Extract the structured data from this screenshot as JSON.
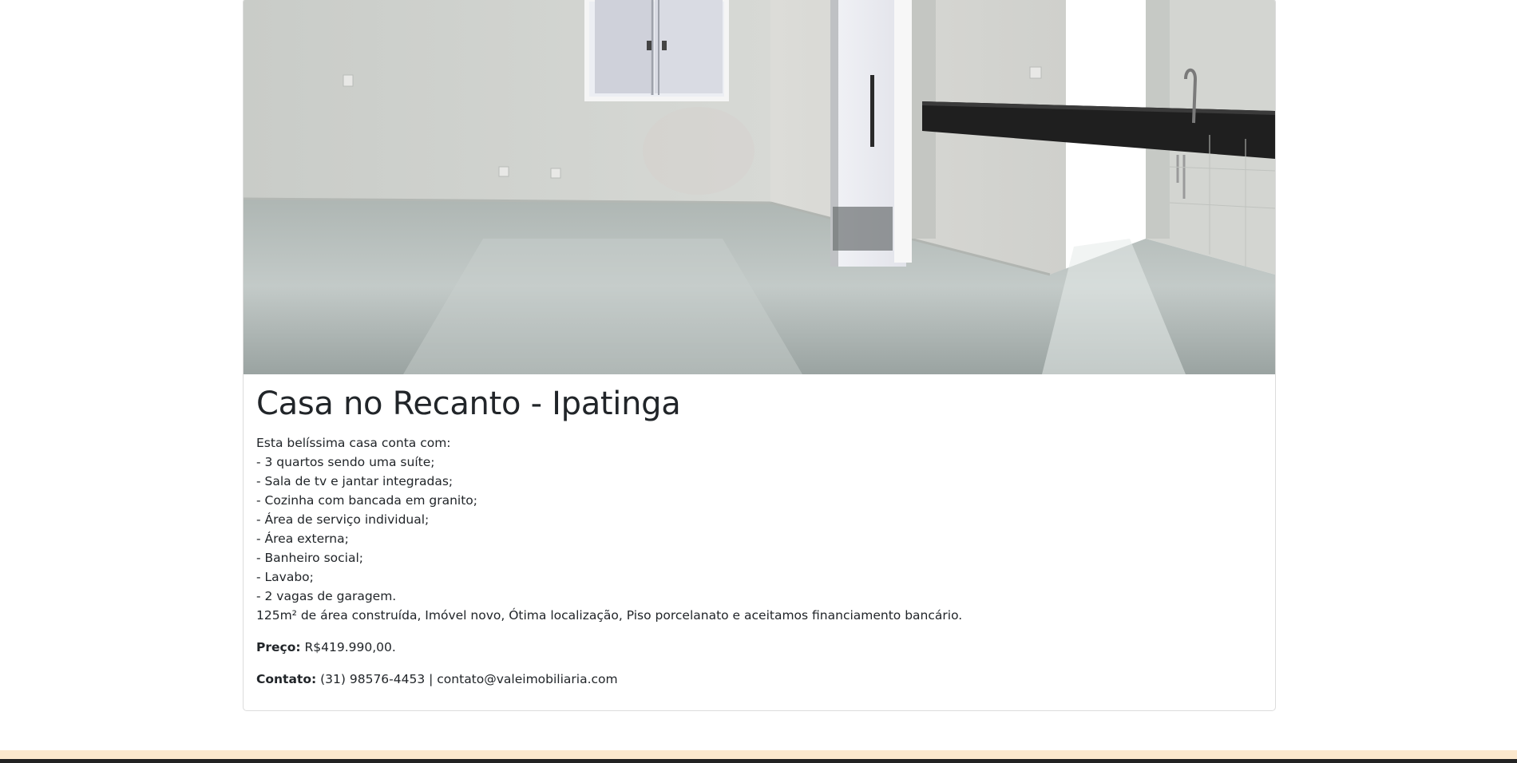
{
  "listing": {
    "title": "Casa no Recanto - Ipatinga",
    "photo_icon": "property-photo-empty-room",
    "description": [
      "Esta belíssima casa conta com:",
      "- 3 quartos sendo uma suíte;",
      "- Sala de tv e jantar integradas;",
      "- Cozinha com bancada em granito;",
      "- Área de serviço individual;",
      "- Área externa;",
      "- Banheiro social;",
      "- Lavabo;",
      "- 2 vagas de garagem.",
      "125m² de área construída, Imóvel novo, Ótima localização, Piso porcelanato e aceitamos financiamento bancário."
    ],
    "price_label": "Preço:",
    "price_value": " R$419.990,00.",
    "contact_label": "Contato:",
    "contact_value": " (31) 98576-4453 | contato@valeimobiliaria.com"
  },
  "colors": {
    "footer_background": "#fbe8cd",
    "footer_bar": "#222222",
    "card_border": "#dcdcdc",
    "text": "#212529"
  }
}
